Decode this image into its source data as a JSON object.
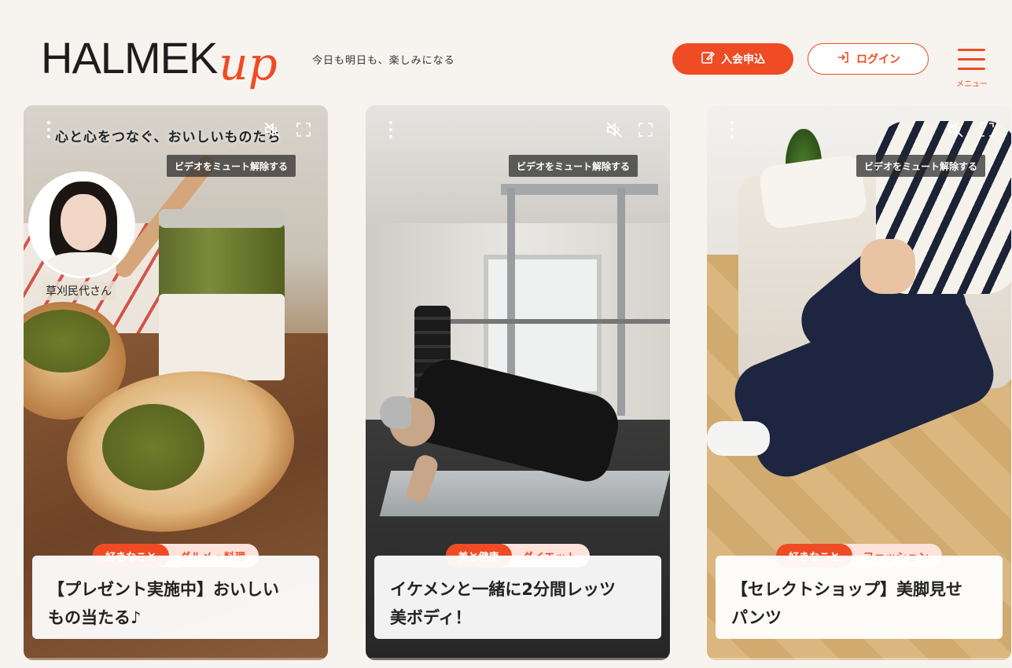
{
  "header": {
    "logo_main": "HALMEK",
    "logo_accent": "up",
    "tagline": "今日も明日も、楽しみになる",
    "join_label": "入会申込",
    "login_label": "ログイン",
    "menu_label": "メニュー"
  },
  "colors": {
    "accent": "#ef4b24",
    "background": "#f7f3ee",
    "tag_light": "#fde3dc"
  },
  "video_controls": {
    "unmute_label": "ビデオをミュート解除する",
    "icons": [
      "more-vertical-icon",
      "muted-speaker-icon",
      "fullscreen-icon"
    ]
  },
  "cards": [
    {
      "overlay_title": "心と心をつなぐ、おいしいものたち",
      "person_name": "草刈民代さん",
      "tag_primary": "好きなこと",
      "tag_secondary": "グルメ・料理",
      "caption_line1": "【プレゼント実施中】おいしい",
      "caption_line2": "もの当たる♪"
    },
    {
      "tag_primary": "美と健康",
      "tag_secondary": "ダイエット",
      "caption_line1": "イケメンと一緒に2分間レッツ",
      "caption_line2": "美ボディ！"
    },
    {
      "tag_primary": "好きなこと",
      "tag_secondary": "ファッション",
      "caption_line1": "【セレクトショップ】美脚見せ",
      "caption_line2": "パンツ"
    }
  ]
}
